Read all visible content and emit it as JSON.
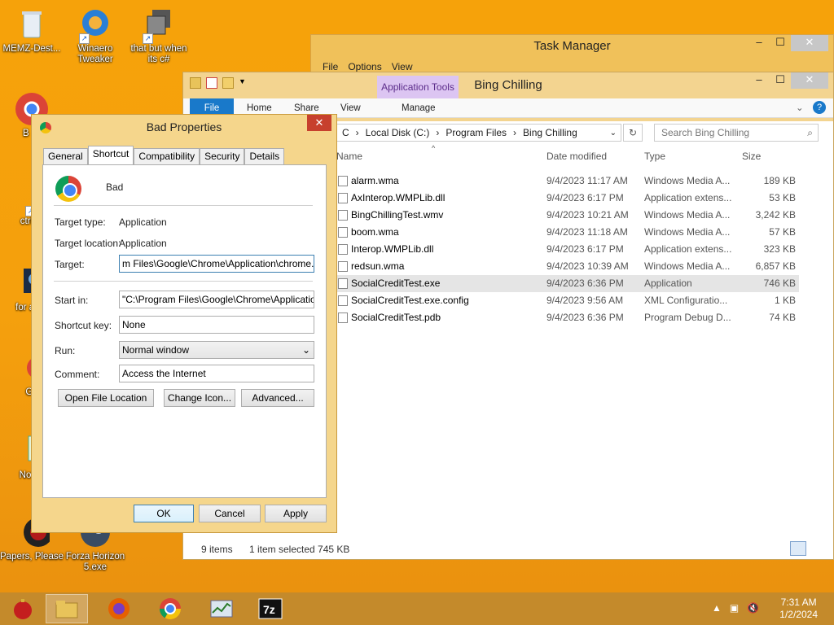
{
  "desktop": {
    "icons": [
      {
        "label": "MEMZ-Dest...",
        "icon": "recycle-bin-icon"
      },
      {
        "label": "Winaero Tweaker",
        "icon": "winaero-icon"
      },
      {
        "label": "that but when its c#",
        "icon": "app-icon"
      },
      {
        "label": "B",
        "icon": "chrome-icon"
      },
      {
        "label": "ctrl+a",
        "icon": "app-icon"
      },
      {
        "label": "for attra",
        "icon": "gear-icon"
      },
      {
        "label": "Go",
        "icon": "chrome-icon"
      },
      {
        "label": "Notep",
        "icon": "notepad-icon"
      },
      {
        "label": "Papers, Please",
        "icon": "papers-please-icon"
      },
      {
        "label": "Forza Horizon 5.exe",
        "icon": "steam-icon"
      }
    ]
  },
  "task_manager": {
    "title": "Task Manager",
    "menu": [
      "File",
      "Options",
      "View"
    ]
  },
  "explorer": {
    "title": "Bing Chilling",
    "contextual_tab": "Application Tools",
    "tabs": [
      "File",
      "Home",
      "Share",
      "View",
      "Manage"
    ],
    "breadcrumb": [
      "C",
      "Local Disk (C:)",
      "Program Files",
      "Bing Chilling"
    ],
    "search_placeholder": "Search Bing Chilling",
    "columns": [
      "Name",
      "Date modified",
      "Type",
      "Size"
    ],
    "files": [
      {
        "name": "alarm.wma",
        "date": "9/4/2023 11:17 AM",
        "type": "Windows Media A...",
        "size": "189 KB",
        "selected": false
      },
      {
        "name": "AxInterop.WMPLib.dll",
        "date": "9/4/2023 6:17 PM",
        "type": "Application extens...",
        "size": "53 KB",
        "selected": false
      },
      {
        "name": "BingChillingTest.wmv",
        "date": "9/4/2023 10:21 AM",
        "type": "Windows Media A...",
        "size": "3,242 KB",
        "selected": false
      },
      {
        "name": "boom.wma",
        "date": "9/4/2023 11:18 AM",
        "type": "Windows Media A...",
        "size": "57 KB",
        "selected": false
      },
      {
        "name": "Interop.WMPLib.dll",
        "date": "9/4/2023 6:17 PM",
        "type": "Application extens...",
        "size": "323 KB",
        "selected": false
      },
      {
        "name": "redsun.wma",
        "date": "9/4/2023 10:39 AM",
        "type": "Windows Media A...",
        "size": "6,857 KB",
        "selected": false
      },
      {
        "name": "SocialCreditTest.exe",
        "date": "9/4/2023 6:36 PM",
        "type": "Application",
        "size": "746 KB",
        "selected": true
      },
      {
        "name": "SocialCreditTest.exe.config",
        "date": "9/4/2023 9:56 AM",
        "type": "XML Configuratio...",
        "size": "1 KB",
        "selected": false
      },
      {
        "name": "SocialCreditTest.pdb",
        "date": "9/4/2023 6:36 PM",
        "type": "Program Debug D...",
        "size": "74 KB",
        "selected": false
      }
    ],
    "status_items": "9 items",
    "status_selected": "1 item selected  745 KB"
  },
  "properties": {
    "title": "Bad Properties",
    "tabs": [
      "General",
      "Shortcut",
      "Compatibility",
      "Security",
      "Details"
    ],
    "active_tab": "Shortcut",
    "name": "Bad",
    "target_type_label": "Target type:",
    "target_type": "Application",
    "target_location_label": "Target location:",
    "target_location": "Application",
    "target_label": "Target:",
    "target": "m Files\\Google\\Chrome\\Application\\chrome.exe\"",
    "start_in_label": "Start in:",
    "start_in": "\"C:\\Program Files\\Google\\Chrome\\Application\"",
    "shortcut_key_label": "Shortcut key:",
    "shortcut_key": "None",
    "run_label": "Run:",
    "run": "Normal window",
    "comment_label": "Comment:",
    "comment": "Access the Internet",
    "open_file_location": "Open File Location",
    "change_icon": "Change Icon...",
    "advanced": "Advanced...",
    "ok": "OK",
    "cancel": "Cancel",
    "apply": "Apply"
  },
  "taskbar": {
    "time": "7:31 AM",
    "date": "1/2/2024"
  }
}
